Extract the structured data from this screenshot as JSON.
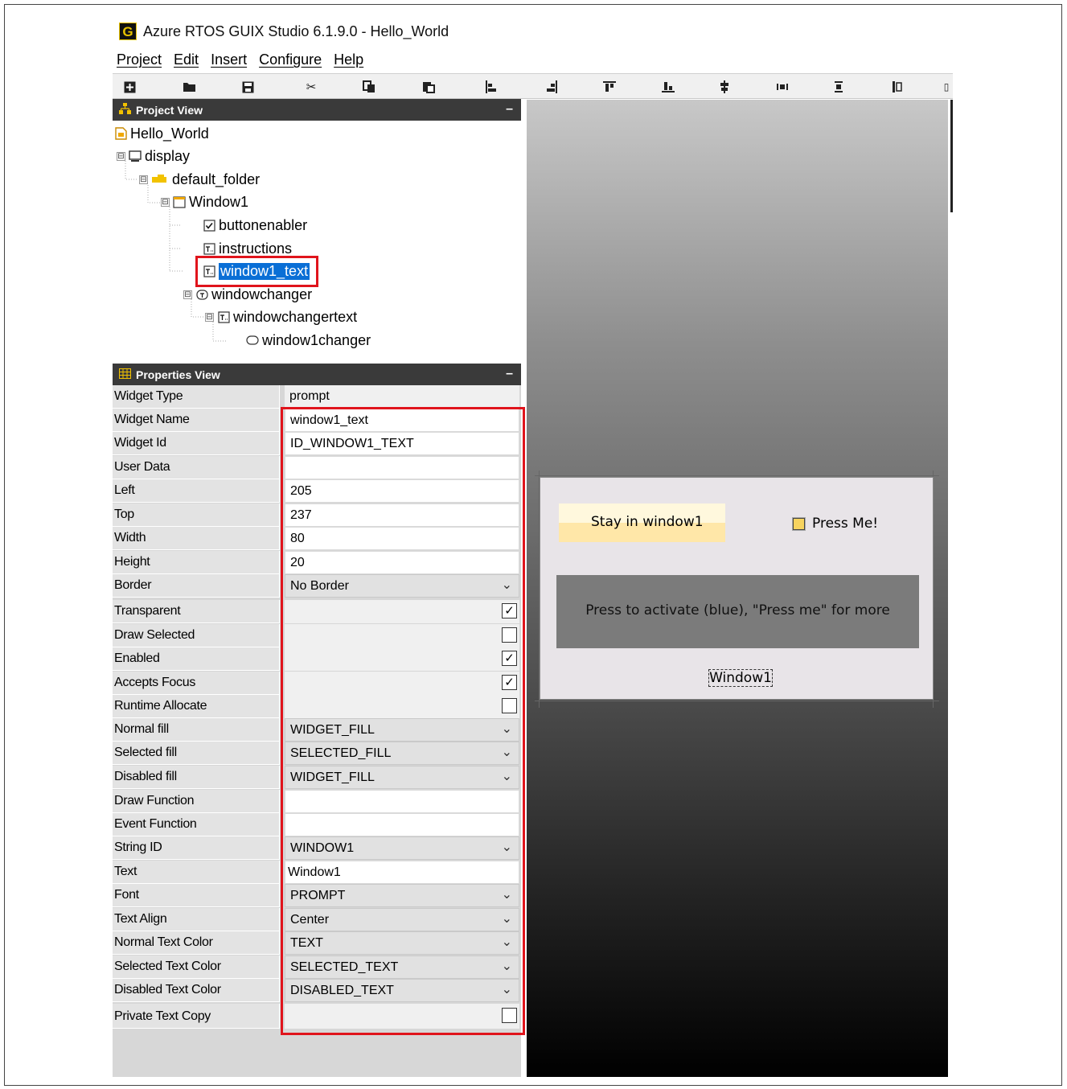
{
  "window": {
    "title": "Azure RTOS GUIX Studio 6.1.9.0 - Hello_World",
    "logo": "G"
  },
  "menu": [
    "Project",
    "Edit",
    "Insert",
    "Configure",
    "Help"
  ],
  "toolbar": [
    "new-project-icon",
    "open-folder-icon",
    "save-icon",
    "cut-icon",
    "copy-icon",
    "paste-icon",
    "align-left-icon",
    "align-right-icon",
    "align-top-icon",
    "align-bottom-icon",
    "center-vertical-icon",
    "equal-width-icon",
    "equal-height-icon",
    "size-to-fit-icon"
  ],
  "project_view": {
    "header": "Project View",
    "minimize": "–",
    "tree": [
      {
        "label": "Hello_World",
        "icon": "project-icon"
      },
      {
        "label": "display",
        "icon": "monitor-icon",
        "expander": "⊟"
      },
      {
        "label": "default_folder",
        "icon": "folder-icon",
        "expander": "⊟"
      },
      {
        "label": "Window1",
        "icon": "window-icon",
        "expander": "⊟"
      },
      {
        "label": "buttonenabler",
        "icon": "checkbox-icon"
      },
      {
        "label": "instructions",
        "icon": "prompt-icon"
      },
      {
        "label": "window1_text",
        "icon": "prompt-icon",
        "selected": true
      },
      {
        "label": "windowchanger",
        "icon": "text-button-icon",
        "expander": "⊟"
      },
      {
        "label": "windowchangertext",
        "icon": "prompt-icon",
        "expander": "⊟"
      },
      {
        "label": "window1changer",
        "icon": "button-icon"
      }
    ]
  },
  "properties_view": {
    "header": "Properties View",
    "minimize": "–",
    "rows": [
      {
        "name": "Widget Type",
        "value": "prompt",
        "kind": "plain"
      },
      {
        "name": "Widget Name",
        "value": "window1_text",
        "kind": "text"
      },
      {
        "name": "Widget Id",
        "value": "ID_WINDOW1_TEXT",
        "kind": "text"
      },
      {
        "name": "User Data",
        "value": "",
        "kind": "text"
      },
      {
        "name": "Left",
        "value": "205",
        "kind": "text"
      },
      {
        "name": "Top",
        "value": "237",
        "kind": "text"
      },
      {
        "name": "Width",
        "value": "80",
        "kind": "text"
      },
      {
        "name": "Height",
        "value": "20",
        "kind": "text"
      },
      {
        "name": "Border",
        "value": "No Border",
        "kind": "combo"
      },
      {
        "name": "Transparent",
        "value": "",
        "kind": "check",
        "checked": true
      },
      {
        "name": "Draw Selected",
        "value": "",
        "kind": "check",
        "checked": false
      },
      {
        "name": "Enabled",
        "value": "",
        "kind": "check",
        "checked": true
      },
      {
        "name": "Accepts Focus",
        "value": "",
        "kind": "check",
        "checked": true
      },
      {
        "name": "Runtime Allocate",
        "value": "",
        "kind": "check",
        "checked": false
      },
      {
        "name": "Normal fill",
        "value": "WIDGET_FILL",
        "kind": "combo"
      },
      {
        "name": "Selected fill",
        "value": "SELECTED_FILL",
        "kind": "combo"
      },
      {
        "name": "Disabled fill",
        "value": "WIDGET_FILL",
        "kind": "combo"
      },
      {
        "name": "Draw Function",
        "value": "",
        "kind": "text"
      },
      {
        "name": "Event Function",
        "value": "",
        "kind": "text"
      },
      {
        "name": "String ID",
        "value": "WINDOW1",
        "kind": "combo"
      },
      {
        "name": "Text",
        "value": "Window1",
        "kind": "text"
      },
      {
        "name": "Font",
        "value": "PROMPT",
        "kind": "combo"
      },
      {
        "name": "Text Align",
        "value": "Center",
        "kind": "combo"
      },
      {
        "name": "Normal Text Color",
        "value": "TEXT",
        "kind": "combo"
      },
      {
        "name": "Selected Text Color",
        "value": "SELECTED_TEXT",
        "kind": "combo"
      },
      {
        "name": "Disabled Text Color",
        "value": "DISABLED_TEXT",
        "kind": "combo"
      },
      {
        "name": "Private Text Copy",
        "value": "",
        "kind": "check",
        "checked": false
      }
    ]
  },
  "preview": {
    "stay_button": "Stay in window1",
    "press_me": "Press Me!",
    "instructions": "Press to activate (blue), \"Press me\" for more",
    "window_label": "Window1"
  },
  "colors": {
    "highlight": "#e0141c",
    "selection": "#0a6fd6",
    "panel_header": "#3a3a3a"
  }
}
